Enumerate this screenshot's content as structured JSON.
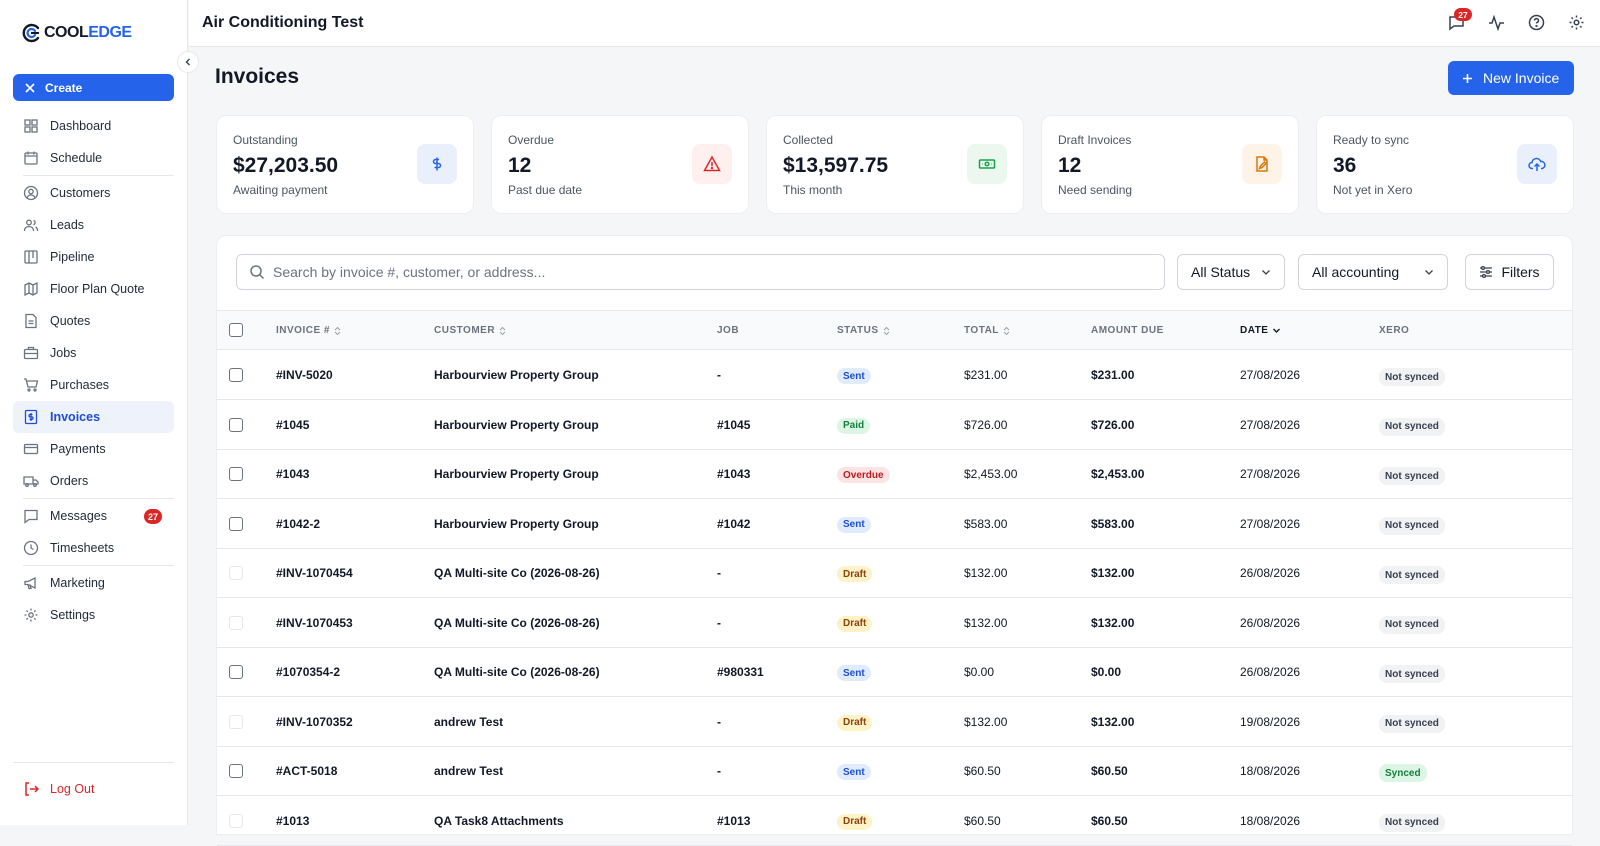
{
  "brand": {
    "name_part1": "COOL",
    "name_part2": "EDGE"
  },
  "app_title": "Air Conditioning Test",
  "top_icons": {
    "messages_badge": "27"
  },
  "sidebar": {
    "create_label": "Create",
    "items": [
      {
        "label": "Dashboard",
        "icon": "dashboard-icon"
      },
      {
        "label": "Schedule",
        "icon": "calendar-icon"
      },
      {
        "label": "Customers",
        "icon": "user-circle-icon"
      },
      {
        "label": "Leads",
        "icon": "users-icon"
      },
      {
        "label": "Pipeline",
        "icon": "pipeline-icon"
      },
      {
        "label": "Floor Plan Quote",
        "icon": "map-icon"
      },
      {
        "label": "Quotes",
        "icon": "document-icon"
      },
      {
        "label": "Jobs",
        "icon": "briefcase-icon"
      },
      {
        "label": "Purchases",
        "icon": "cart-icon"
      },
      {
        "label": "Invoices",
        "icon": "invoice-icon"
      },
      {
        "label": "Payments",
        "icon": "credit-card-icon"
      },
      {
        "label": "Orders",
        "icon": "truck-icon"
      },
      {
        "label": "Messages",
        "icon": "message-icon",
        "badge": "27"
      },
      {
        "label": "Timesheets",
        "icon": "clock-icon"
      },
      {
        "label": "Marketing",
        "icon": "megaphone-icon"
      },
      {
        "label": "Settings",
        "icon": "gear-icon"
      }
    ],
    "logout_label": "Log Out"
  },
  "page": {
    "title": "Invoices",
    "new_button": "New Invoice"
  },
  "cards": [
    {
      "label": "Outstanding",
      "value": "$27,203.50",
      "sub": "Awaiting payment",
      "icon": "dollar-icon",
      "color": "#2563eb",
      "bg": "#eaf0fb"
    },
    {
      "label": "Overdue",
      "value": "12",
      "sub": "Past due date",
      "icon": "alert-triangle-icon",
      "color": "#dc2626",
      "bg": "#fdf0ef"
    },
    {
      "label": "Collected",
      "value": "$13,597.75",
      "sub": "This month",
      "icon": "cash-icon",
      "color": "#16a34a",
      "bg": "#ebf7ef"
    },
    {
      "label": "Draft Invoices",
      "value": "12",
      "sub": "Need sending",
      "icon": "file-edit-icon",
      "color": "#d97706",
      "bg": "#fdf3e6"
    },
    {
      "label": "Ready to sync",
      "value": "36",
      "sub": "Not yet in Xero",
      "icon": "cloud-upload-icon",
      "color": "#2563eb",
      "bg": "#eaf0fb"
    }
  ],
  "filters": {
    "search_placeholder": "Search by invoice #, customer, or address...",
    "status_select": "All Status",
    "accounting_select": "All accounting",
    "filters_button": "Filters"
  },
  "table": {
    "columns": {
      "invoice": "INVOICE #",
      "customer": "CUSTOMER",
      "job": "JOB",
      "status": "STATUS",
      "total": "TOTAL",
      "amount_due": "AMOUNT DUE",
      "date": "DATE",
      "xero": "XERO"
    },
    "rows": [
      {
        "invoice": "#INV-5020",
        "customer": "Harbourview Property Group",
        "job": "-",
        "status": "Sent",
        "total": "$231.00",
        "amount_due": "$231.00",
        "date": "27/08/2026",
        "xero": "Not synced"
      },
      {
        "invoice": "#1045",
        "customer": "Harbourview Property Group",
        "job": "#1045",
        "status": "Paid",
        "total": "$726.00",
        "amount_due": "$726.00",
        "date": "27/08/2026",
        "xero": "Not synced"
      },
      {
        "invoice": "#1043",
        "customer": "Harbourview Property Group",
        "job": "#1043",
        "status": "Overdue",
        "total": "$2,453.00",
        "amount_due": "$2,453.00",
        "date": "27/08/2026",
        "xero": "Not synced"
      },
      {
        "invoice": "#1042-2",
        "customer": "Harbourview Property Group",
        "job": "#1042",
        "status": "Sent",
        "total": "$583.00",
        "amount_due": "$583.00",
        "date": "27/08/2026",
        "xero": "Not synced"
      },
      {
        "invoice": "#INV-1070454",
        "customer": "QA Multi-site Co (2026-08-26)",
        "job": "-",
        "status": "Draft",
        "total": "$132.00",
        "amount_due": "$132.00",
        "date": "26/08/2026",
        "xero": "Not synced"
      },
      {
        "invoice": "#INV-1070453",
        "customer": "QA Multi-site Co (2026-08-26)",
        "job": "-",
        "status": "Draft",
        "total": "$132.00",
        "amount_due": "$132.00",
        "date": "26/08/2026",
        "xero": "Not synced"
      },
      {
        "invoice": "#1070354-2",
        "customer": "QA Multi-site Co (2026-08-26)",
        "job": "#980331",
        "status": "Sent",
        "total": "$0.00",
        "amount_due": "$0.00",
        "date": "26/08/2026",
        "xero": "Not synced"
      },
      {
        "invoice": "#INV-1070352",
        "customer": "andrew Test",
        "job": "-",
        "status": "Draft",
        "total": "$132.00",
        "amount_due": "$132.00",
        "date": "19/08/2026",
        "xero": "Not synced"
      },
      {
        "invoice": "#ACT-5018",
        "customer": "andrew Test",
        "job": "-",
        "status": "Sent",
        "total": "$60.50",
        "amount_due": "$60.50",
        "date": "18/08/2026",
        "xero": "Synced"
      },
      {
        "invoice": "#1013",
        "customer": "QA Task8 Attachments",
        "job": "#1013",
        "status": "Draft",
        "total": "$60.50",
        "amount_due": "$60.50",
        "date": "18/08/2026",
        "xero": "Not synced"
      }
    ]
  }
}
